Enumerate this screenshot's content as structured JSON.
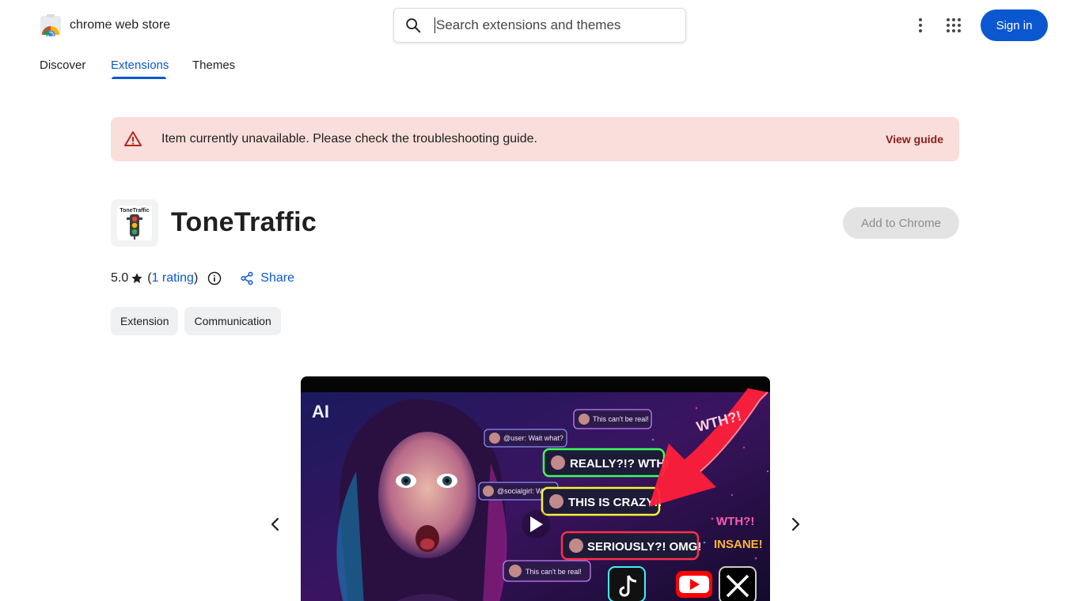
{
  "header": {
    "logo_text": "chrome web store",
    "search_placeholder": "Search extensions and themes",
    "signin_label": "Sign in",
    "icons": {
      "search": "search-icon",
      "more": "more-vert-icon",
      "apps": "apps-grid-icon"
    }
  },
  "nav": {
    "tabs": [
      {
        "label": "Discover",
        "active": false
      },
      {
        "label": "Extensions",
        "active": true
      },
      {
        "label": "Themes",
        "active": false
      }
    ]
  },
  "banner": {
    "text": "Item currently unavailable. Please check the troubleshooting guide.",
    "link_label": "View guide",
    "icon": "warning-icon"
  },
  "item": {
    "title": "ToneTraffic",
    "icon_label": "ToneTraffic",
    "add_label": "Add to Chrome",
    "rating_value": "5.0",
    "rating_open": "(",
    "rating_link": "1 rating",
    "rating_close": ")",
    "share_label": "Share",
    "chips": [
      "Extension",
      "Communication"
    ]
  },
  "media": {
    "overlay_texts": {
      "ai": "AI",
      "b1": "This can't be real!",
      "b2": "@user: Wait what?",
      "b3": "REALLY?!? WTH!",
      "b4": "@socialgirl: WOW",
      "b5": "THIS IS CRAZY!!",
      "b6": "SERIOUSLY?! OMG!",
      "b7": "This can't be real!",
      "wth1": "WTH?!",
      "wth2": "WTH?!",
      "insane": "INSANE!"
    }
  },
  "colors": {
    "accent": "#0b57d0",
    "banner_bg": "#f9dedc",
    "banner_link": "#8c1d18",
    "warning": "#b3261e"
  }
}
